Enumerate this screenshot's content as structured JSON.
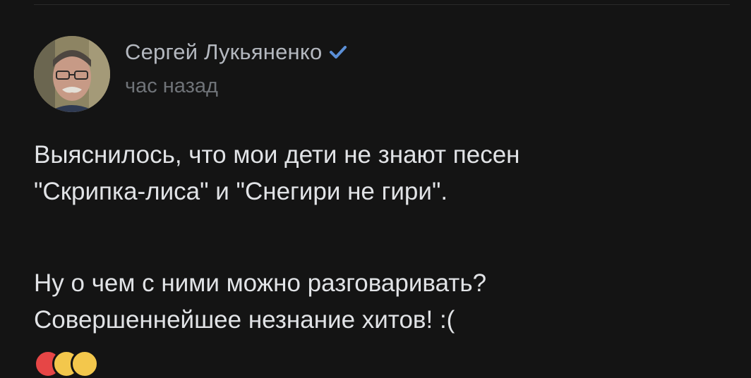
{
  "post": {
    "author": {
      "name": "Сергей Лукьяненко",
      "verified": true,
      "avatar_icon": "author-avatar-photo"
    },
    "time": "час назад",
    "text": {
      "paragraph1": [
        "Выяснилось, что мои дети не знают песен",
        "\"Скрипка-лиса\" и \"Снегири не гири\"."
      ],
      "paragraph2": [
        "Ну о чем с ними можно разговаривать?",
        "Совершеннейшее незнание хитов! :("
      ]
    },
    "reactions": [
      {
        "icon": "heart-reaction-icon",
        "color": "#e64646"
      },
      {
        "icon": "laugh-reaction-icon",
        "color": "#f3c74c"
      },
      {
        "icon": "sad-reaction-icon",
        "color": "#f3c74c"
      }
    ]
  },
  "colors": {
    "background": "#141414",
    "text_primary": "#e1e3e6",
    "author_name": "#b4b8bf",
    "secondary": "#6f7378",
    "verified": "#5b8fd6"
  }
}
